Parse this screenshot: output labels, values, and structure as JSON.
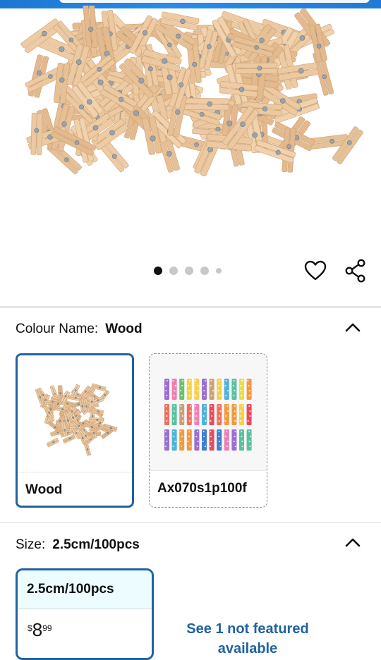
{
  "colors": {
    "selected_border": "#2162a1",
    "link": "#2162a1",
    "divider": "#e3e6e6",
    "wood": "#e6c197"
  },
  "gallery": {
    "image_alt": "mini wooden clothespins",
    "dots_total": 5,
    "dots_active_index": 0,
    "actions": [
      {
        "icon": "heart-icon"
      },
      {
        "icon": "share-icon"
      }
    ]
  },
  "colour": {
    "label": "Colour Name:",
    "value": "Wood",
    "options": [
      {
        "label": "Wood",
        "selected": true
      },
      {
        "label": "Ax070s1p100f",
        "selected": false
      }
    ]
  },
  "size": {
    "label": "Size:",
    "value": "2.5cm/100pcs",
    "options": [
      {
        "label": "2.5cm/100pcs",
        "selected": true,
        "price_currency": "$",
        "price_whole": "8",
        "price_fraction": "99"
      }
    ],
    "see_more": "See 1 not featured available"
  }
}
